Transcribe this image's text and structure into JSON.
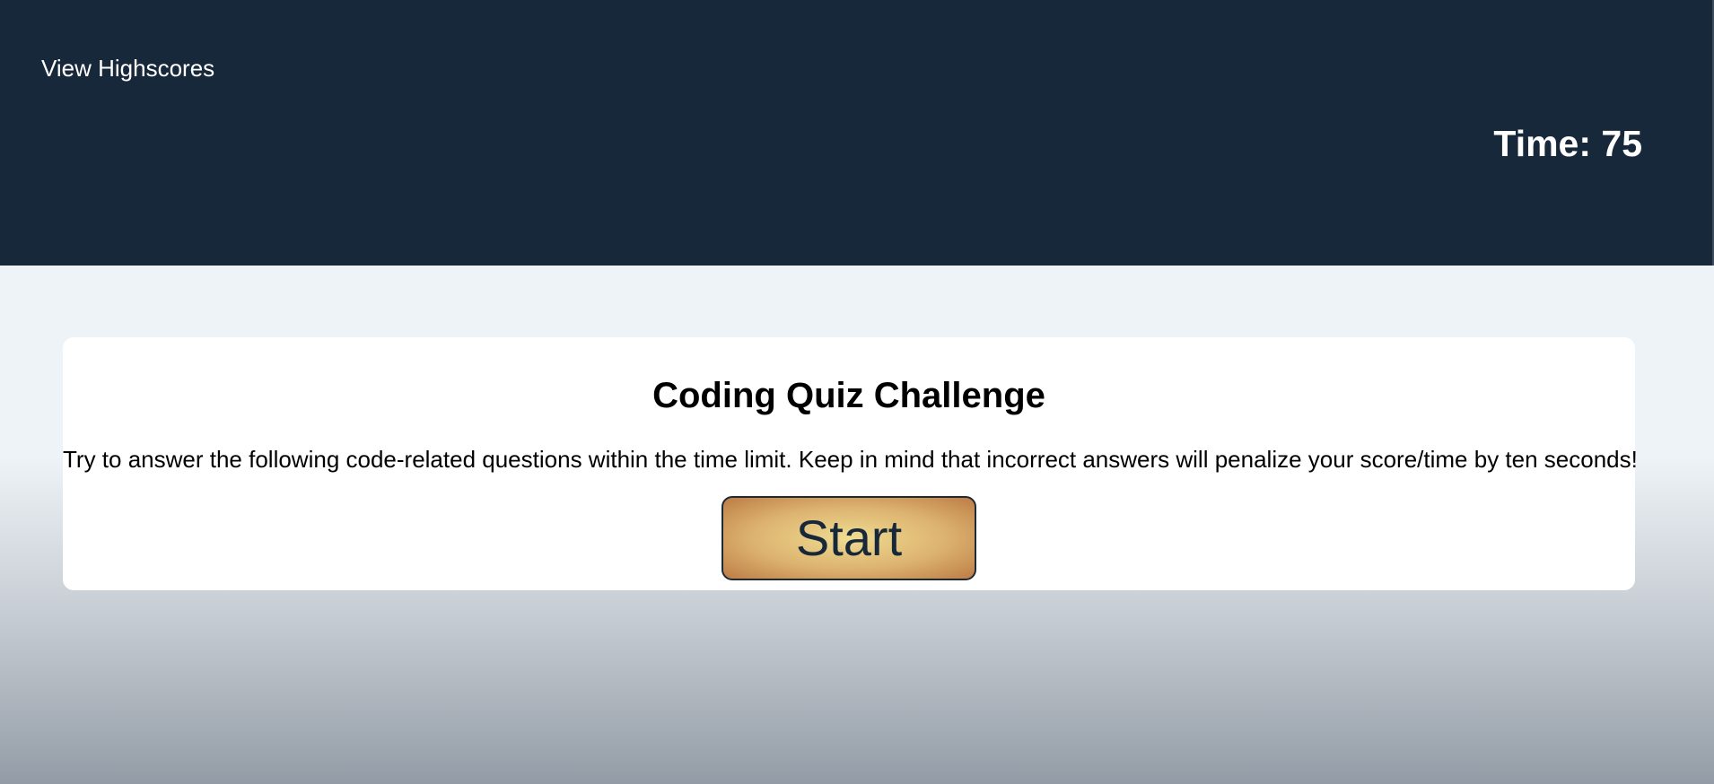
{
  "header": {
    "highscores_link": "View Highscores",
    "timer": "Time: 75",
    "background_color": "#18283b"
  },
  "card": {
    "title": "Coding Quiz Challenge",
    "description": "Try to answer the following code-related questions within the time limit. Keep in mind that incorrect answers will penalize your score/time by ten seconds!",
    "start_label": "Start",
    "start_button_color": "#dcb26f"
  }
}
